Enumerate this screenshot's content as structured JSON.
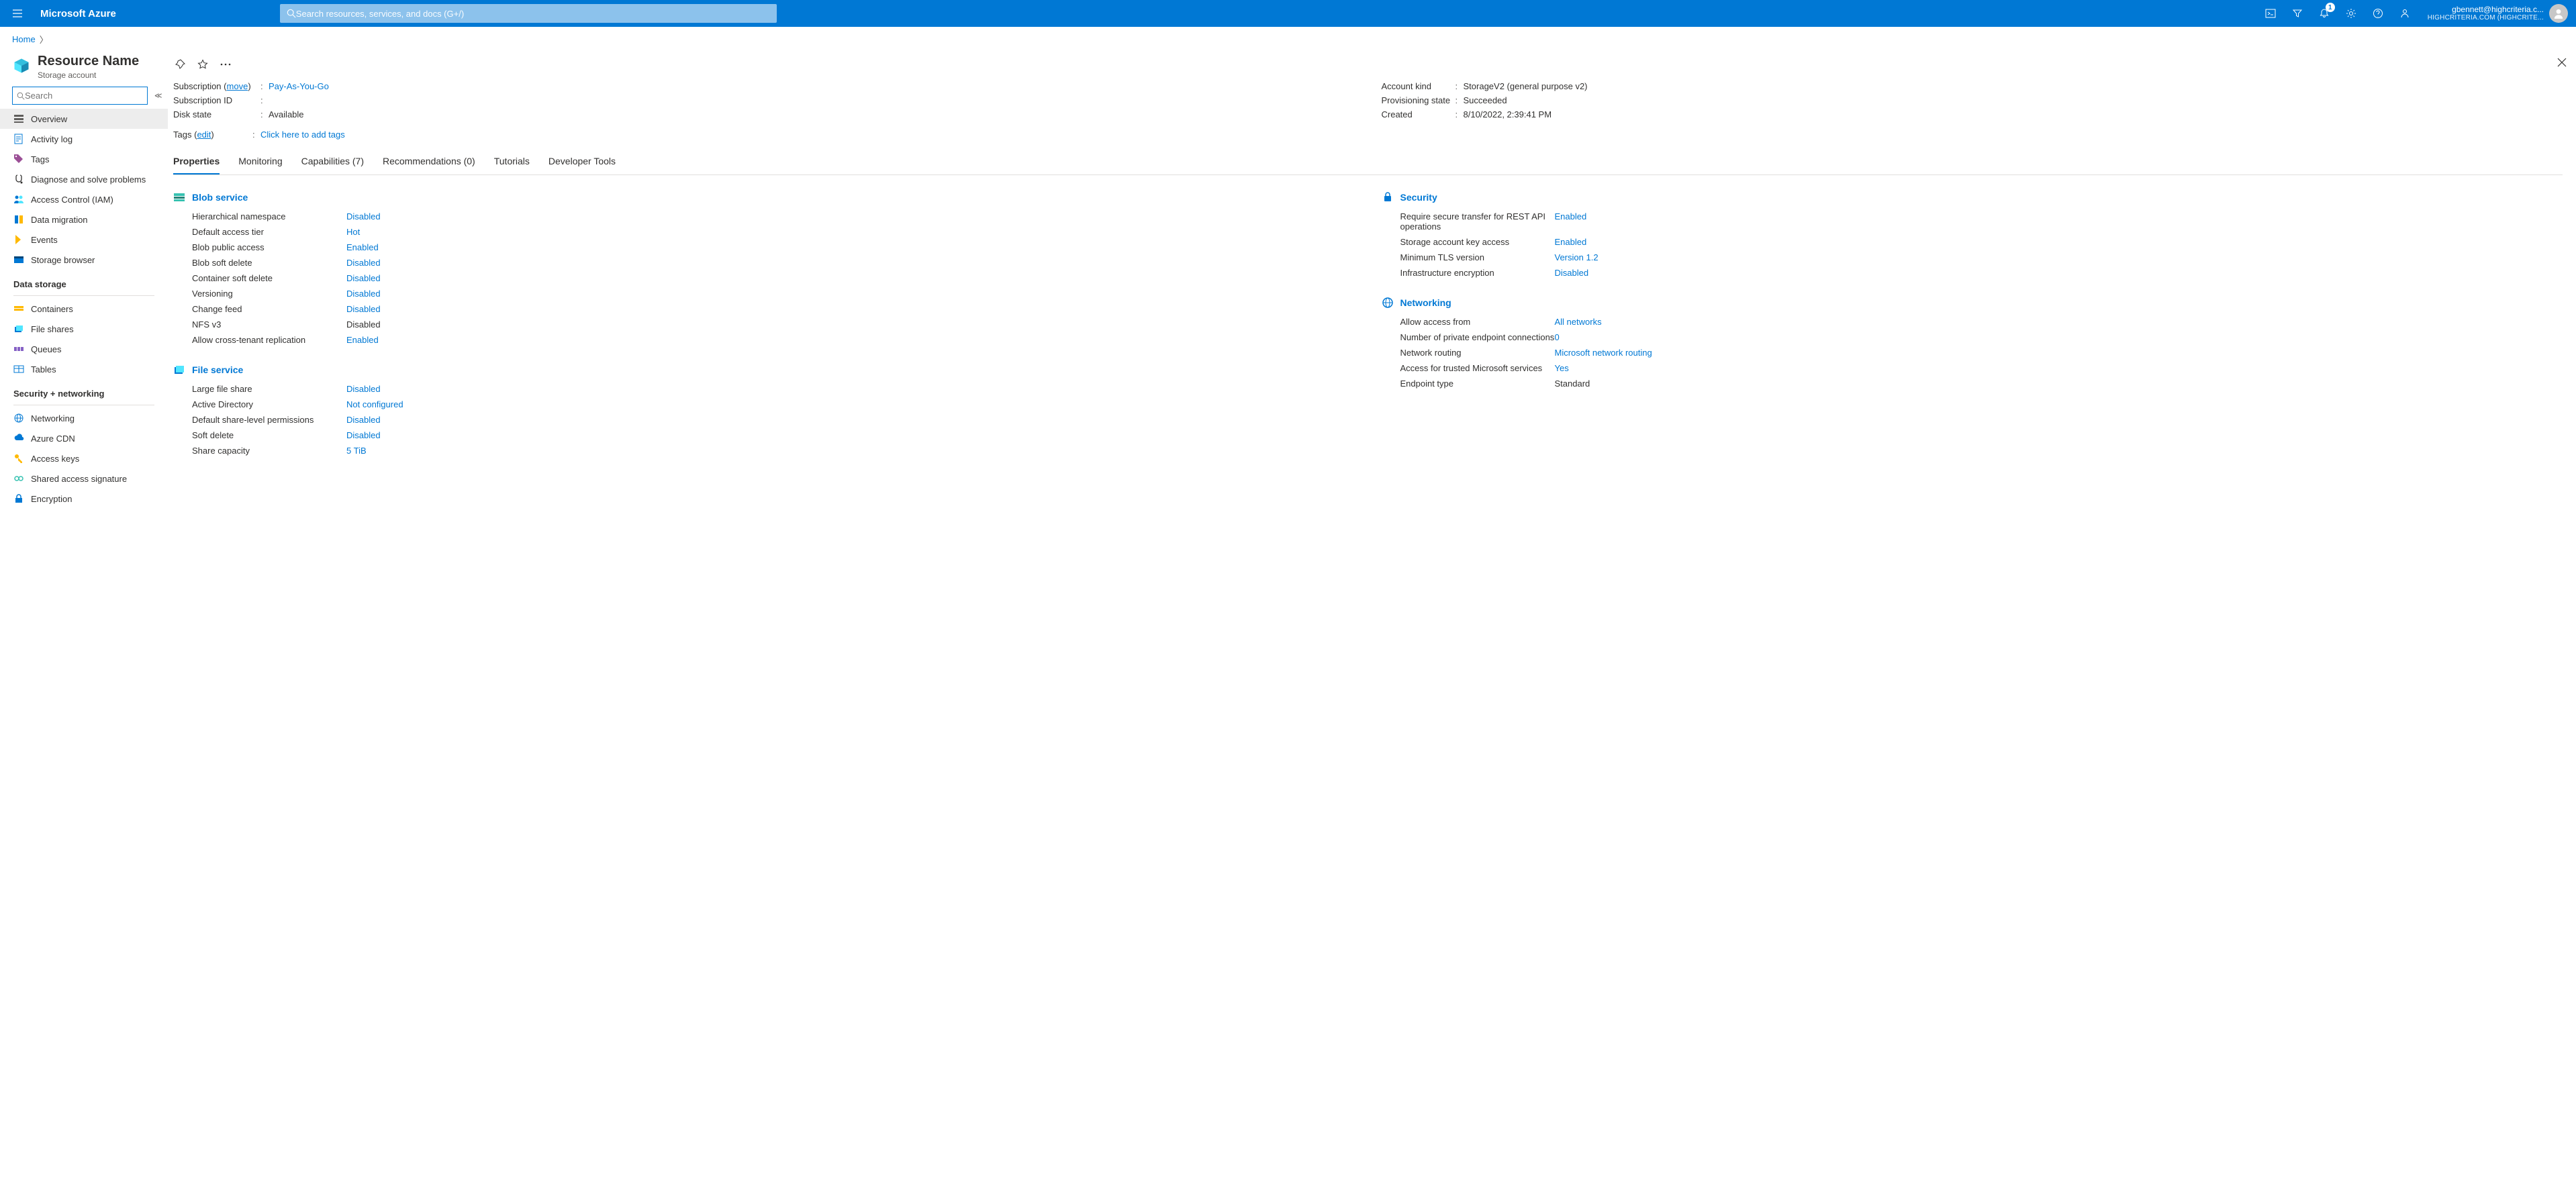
{
  "brand": "Microsoft Azure",
  "search_placeholder": "Search resources, services, and docs (G+/)",
  "notif_badge": "1",
  "account": {
    "name": "gbennett@highcriteria.c...",
    "dir": "HIGHCRITERIA.COM (HIGHCRITE..."
  },
  "breadcrumb": {
    "home": "Home"
  },
  "resource": {
    "title": "Resource Name",
    "subtitle": "Storage account"
  },
  "sidebar_search_placeholder": "Search",
  "sidebar": {
    "top": [
      {
        "label": "Overview",
        "icon": "overview",
        "active": true
      },
      {
        "label": "Activity log",
        "icon": "activity"
      },
      {
        "label": "Tags",
        "icon": "tag"
      },
      {
        "label": "Diagnose and solve problems",
        "icon": "diagnose"
      },
      {
        "label": "Access Control (IAM)",
        "icon": "iam"
      },
      {
        "label": "Data migration",
        "icon": "migration"
      },
      {
        "label": "Events",
        "icon": "events"
      },
      {
        "label": "Storage browser",
        "icon": "browser"
      }
    ],
    "group1_label": "Data storage",
    "group1": [
      {
        "label": "Containers",
        "icon": "containers"
      },
      {
        "label": "File shares",
        "icon": "fileshares"
      },
      {
        "label": "Queues",
        "icon": "queues"
      },
      {
        "label": "Tables",
        "icon": "tables"
      }
    ],
    "group2_label": "Security + networking",
    "group2": [
      {
        "label": "Networking",
        "icon": "networking"
      },
      {
        "label": "Azure CDN",
        "icon": "cdn"
      },
      {
        "label": "Access keys",
        "icon": "keys"
      },
      {
        "label": "Shared access signature",
        "icon": "sas"
      },
      {
        "label": "Encryption",
        "icon": "encryption"
      }
    ]
  },
  "essentials": {
    "left": {
      "subscription_label": "Subscription",
      "subscription_move": "move",
      "subscription_value": "Pay-As-You-Go",
      "subscription_id_label": "Subscription ID",
      "subscription_id_value": "",
      "disk_state_label": "Disk state",
      "disk_state_value": "Available"
    },
    "right": {
      "account_kind_label": "Account kind",
      "account_kind_value": "StorageV2 (general purpose v2)",
      "prov_state_label": "Provisioning state",
      "prov_state_value": "Succeeded",
      "created_label": "Created",
      "created_value": "8/10/2022, 2:39:41 PM"
    },
    "tags_label": "Tags",
    "tags_edit": "edit",
    "tags_value": "Click here to add tags"
  },
  "tabs": [
    {
      "label": "Properties",
      "active": true
    },
    {
      "label": "Monitoring"
    },
    {
      "label": "Capabilities (7)"
    },
    {
      "label": "Recommendations (0)"
    },
    {
      "label": "Tutorials"
    },
    {
      "label": "Developer Tools"
    }
  ],
  "props": {
    "blob": {
      "header": "Blob service",
      "rows": [
        {
          "k": "Hierarchical namespace",
          "v": "Disabled",
          "link": true
        },
        {
          "k": "Default access tier",
          "v": "Hot",
          "link": true
        },
        {
          "k": "Blob public access",
          "v": "Enabled",
          "link": true
        },
        {
          "k": "Blob soft delete",
          "v": "Disabled",
          "link": true
        },
        {
          "k": "Container soft delete",
          "v": "Disabled",
          "link": true
        },
        {
          "k": "Versioning",
          "v": "Disabled",
          "link": true
        },
        {
          "k": "Change feed",
          "v": "Disabled",
          "link": true
        },
        {
          "k": "NFS v3",
          "v": "Disabled",
          "link": false
        },
        {
          "k": "Allow cross-tenant replication",
          "v": "Enabled",
          "link": true
        }
      ]
    },
    "file": {
      "header": "File service",
      "rows": [
        {
          "k": "Large file share",
          "v": "Disabled",
          "link": true
        },
        {
          "k": "Active Directory",
          "v": "Not configured",
          "link": true
        },
        {
          "k": "Default share-level permissions",
          "v": "Disabled",
          "link": true
        },
        {
          "k": "Soft delete",
          "v": "Disabled",
          "link": true
        },
        {
          "k": "Share capacity",
          "v": "5 TiB",
          "link": true
        }
      ]
    },
    "security": {
      "header": "Security",
      "rows": [
        {
          "k": "Require secure transfer for REST API operations",
          "v": "Enabled",
          "link": true
        },
        {
          "k": "Storage account key access",
          "v": "Enabled",
          "link": true
        },
        {
          "k": "Minimum TLS version",
          "v": "Version 1.2",
          "link": true
        },
        {
          "k": "Infrastructure encryption",
          "v": "Disabled",
          "link": true
        }
      ]
    },
    "net": {
      "header": "Networking",
      "rows": [
        {
          "k": "Allow access from",
          "v": "All networks",
          "link": true
        },
        {
          "k": "Number of private endpoint connections",
          "v": "0",
          "link": true
        },
        {
          "k": "Network routing",
          "v": "Microsoft network routing",
          "link": true
        },
        {
          "k": "Access for trusted Microsoft services",
          "v": "Yes",
          "link": true
        },
        {
          "k": "Endpoint type",
          "v": "Standard",
          "link": false
        }
      ]
    }
  }
}
